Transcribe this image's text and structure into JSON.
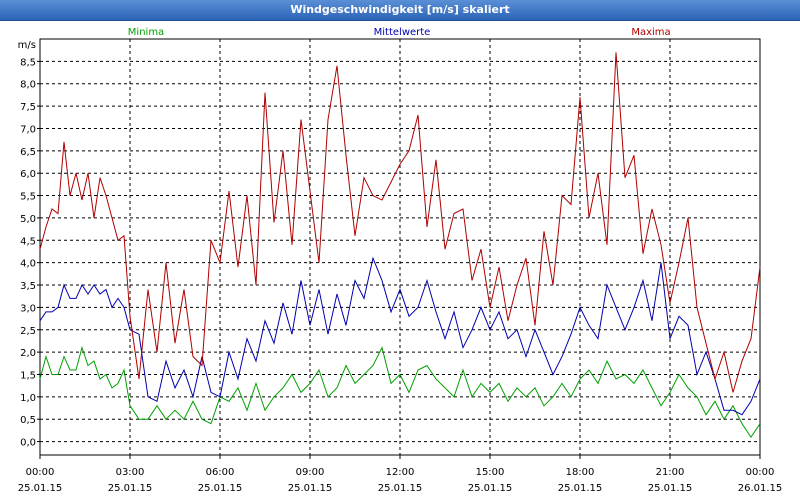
{
  "window": {
    "title": "Windgeschwindigkeit [m/s] skaliert"
  },
  "chart_data": {
    "type": "line",
    "ylabel": "m/s",
    "ylim": [
      -0.3,
      9.0
    ],
    "yticks": [
      "0,0",
      "0,5",
      "1,0",
      "1,5",
      "2,0",
      "2,5",
      "3,0",
      "3,5",
      "4,0",
      "4,5",
      "5,0",
      "5,5",
      "6,0",
      "6,5",
      "7,0",
      "7,5",
      "8,0",
      "8,5"
    ],
    "xlim_hours": [
      0,
      24
    ],
    "xticks": [
      {
        "time": "00:00",
        "date": "25.01.15"
      },
      {
        "time": "03:00",
        "date": "25.01.15"
      },
      {
        "time": "06:00",
        "date": "25.01.15"
      },
      {
        "time": "09:00",
        "date": "25.01.15"
      },
      {
        "time": "12:00",
        "date": "25.01.15"
      },
      {
        "time": "15:00",
        "date": "25.01.15"
      },
      {
        "time": "18:00",
        "date": "25.01.15"
      },
      {
        "time": "21:00",
        "date": "25.01.15"
      },
      {
        "time": "00:00",
        "date": "26.01.15"
      }
    ],
    "grid": true,
    "series": [
      {
        "name": "Minima",
        "color": "#00a000",
        "legend_position": "left",
        "x": [
          0,
          0.2,
          0.4,
          0.6,
          0.8,
          1,
          1.2,
          1.4,
          1.6,
          1.8,
          2,
          2.2,
          2.4,
          2.6,
          2.8,
          3,
          3.3,
          3.6,
          3.9,
          4.2,
          4.5,
          4.8,
          5.1,
          5.4,
          5.7,
          6,
          6.3,
          6.6,
          6.9,
          7.2,
          7.5,
          7.8,
          8.1,
          8.4,
          8.7,
          9,
          9.3,
          9.6,
          9.9,
          10.2,
          10.5,
          10.8,
          11.1,
          11.4,
          11.7,
          12,
          12.3,
          12.6,
          12.9,
          13.2,
          13.5,
          13.8,
          14.1,
          14.4,
          14.7,
          15,
          15.3,
          15.6,
          15.9,
          16.2,
          16.5,
          16.8,
          17.1,
          17.4,
          17.7,
          18,
          18.3,
          18.6,
          18.9,
          19.2,
          19.5,
          19.8,
          20.1,
          20.4,
          20.7,
          21,
          21.3,
          21.6,
          21.9,
          22.2,
          22.5,
          22.8,
          23.1,
          23.4,
          23.7,
          24
        ],
        "y": [
          1.4,
          1.9,
          1.5,
          1.5,
          1.9,
          1.6,
          1.6,
          2.1,
          1.7,
          1.8,
          1.4,
          1.5,
          1.2,
          1.3,
          1.6,
          0.8,
          0.5,
          0.5,
          0.8,
          0.5,
          0.7,
          0.5,
          0.9,
          0.5,
          0.4,
          1.0,
          0.9,
          1.2,
          0.7,
          1.3,
          0.7,
          1.0,
          1.2,
          1.5,
          1.1,
          1.3,
          1.6,
          1.0,
          1.2,
          1.7,
          1.3,
          1.5,
          1.7,
          2.1,
          1.3,
          1.5,
          1.1,
          1.6,
          1.7,
          1.4,
          1.2,
          1.0,
          1.6,
          1.0,
          1.3,
          1.1,
          1.3,
          0.9,
          1.2,
          1.0,
          1.2,
          0.8,
          1.0,
          1.3,
          1.0,
          1.4,
          1.6,
          1.3,
          1.8,
          1.4,
          1.5,
          1.3,
          1.6,
          1.2,
          0.8,
          1.1,
          1.5,
          1.2,
          1.0,
          0.6,
          0.9,
          0.5,
          0.8,
          0.4,
          0.1,
          0.4
        ]
      },
      {
        "name": "Mittelwerte",
        "color": "#0000b0",
        "legend_position": "center",
        "x": [
          0,
          0.2,
          0.4,
          0.6,
          0.8,
          1,
          1.2,
          1.4,
          1.6,
          1.8,
          2,
          2.2,
          2.4,
          2.6,
          2.8,
          3,
          3.3,
          3.6,
          3.9,
          4.2,
          4.5,
          4.8,
          5.1,
          5.4,
          5.7,
          6,
          6.3,
          6.6,
          6.9,
          7.2,
          7.5,
          7.8,
          8.1,
          8.4,
          8.7,
          9,
          9.3,
          9.6,
          9.9,
          10.2,
          10.5,
          10.8,
          11.1,
          11.4,
          11.7,
          12,
          12.3,
          12.6,
          12.9,
          13.2,
          13.5,
          13.8,
          14.1,
          14.4,
          14.7,
          15,
          15.3,
          15.6,
          15.9,
          16.2,
          16.5,
          16.8,
          17.1,
          17.4,
          17.7,
          18,
          18.3,
          18.6,
          18.9,
          19.2,
          19.5,
          19.8,
          20.1,
          20.4,
          20.7,
          21,
          21.3,
          21.6,
          21.9,
          22.2,
          22.5,
          22.8,
          23.1,
          23.4,
          23.7,
          24
        ],
        "y": [
          2.7,
          2.9,
          2.9,
          3.0,
          3.5,
          3.2,
          3.2,
          3.5,
          3.3,
          3.5,
          3.3,
          3.4,
          3.0,
          3.2,
          3.0,
          2.5,
          2.4,
          1.0,
          0.9,
          1.8,
          1.2,
          1.6,
          1.0,
          1.9,
          1.1,
          1.0,
          2.0,
          1.4,
          2.3,
          1.8,
          2.7,
          2.2,
          3.1,
          2.4,
          3.6,
          2.6,
          3.4,
          2.4,
          3.3,
          2.6,
          3.6,
          3.2,
          4.1,
          3.6,
          2.9,
          3.4,
          2.8,
          3.0,
          3.6,
          2.9,
          2.3,
          2.9,
          2.1,
          2.5,
          3.0,
          2.5,
          2.9,
          2.3,
          2.5,
          1.9,
          2.5,
          2.0,
          1.5,
          1.9,
          2.4,
          3.0,
          2.6,
          2.3,
          3.5,
          3.0,
          2.5,
          3.0,
          3.6,
          2.7,
          4.0,
          2.3,
          2.8,
          2.6,
          1.5,
          2.0,
          1.4,
          0.7,
          0.7,
          0.6,
          0.9,
          1.4
        ]
      },
      {
        "name": "Maxima",
        "color": "#b00000",
        "legend_position": "right",
        "x": [
          0,
          0.2,
          0.4,
          0.6,
          0.8,
          1,
          1.2,
          1.4,
          1.6,
          1.8,
          2,
          2.2,
          2.4,
          2.6,
          2.8,
          3,
          3.3,
          3.6,
          3.9,
          4.2,
          4.5,
          4.8,
          5.1,
          5.4,
          5.7,
          6,
          6.3,
          6.6,
          6.9,
          7.2,
          7.5,
          7.8,
          8.1,
          8.4,
          8.7,
          9,
          9.3,
          9.6,
          9.9,
          10.2,
          10.5,
          10.8,
          11.1,
          11.4,
          11.7,
          12,
          12.3,
          12.6,
          12.9,
          13.2,
          13.5,
          13.8,
          14.1,
          14.4,
          14.7,
          15,
          15.3,
          15.6,
          15.9,
          16.2,
          16.5,
          16.8,
          17.1,
          17.4,
          17.7,
          18,
          18.3,
          18.6,
          18.9,
          19.2,
          19.5,
          19.8,
          20.1,
          20.4,
          20.7,
          21,
          21.3,
          21.6,
          21.9,
          22.2,
          22.5,
          22.8,
          23.1,
          23.4,
          23.7,
          24
        ],
        "y": [
          4.3,
          4.8,
          5.2,
          5.1,
          6.7,
          5.5,
          6.0,
          5.4,
          6.0,
          5.0,
          5.9,
          5.5,
          5.0,
          4.5,
          4.6,
          2.8,
          1.4,
          3.4,
          2.0,
          4.0,
          2.2,
          3.4,
          1.9,
          1.7,
          4.5,
          4.0,
          5.6,
          3.9,
          5.5,
          3.5,
          7.8,
          4.9,
          6.5,
          4.4,
          7.2,
          5.6,
          4.0,
          7.2,
          8.4,
          6.4,
          4.6,
          5.9,
          5.5,
          5.4,
          5.8,
          6.2,
          6.5,
          7.3,
          4.8,
          6.3,
          4.3,
          5.1,
          5.2,
          3.6,
          4.3,
          3.0,
          3.9,
          2.7,
          3.5,
          4.1,
          2.6,
          4.7,
          3.5,
          5.5,
          5.3,
          7.7,
          5.0,
          6.0,
          4.4,
          8.7,
          5.9,
          6.4,
          4.2,
          5.2,
          4.4,
          3.1,
          4.0,
          5.0,
          3.0,
          2.2,
          1.4,
          2.0,
          1.1,
          1.8,
          2.3,
          3.9
        ]
      }
    ]
  }
}
